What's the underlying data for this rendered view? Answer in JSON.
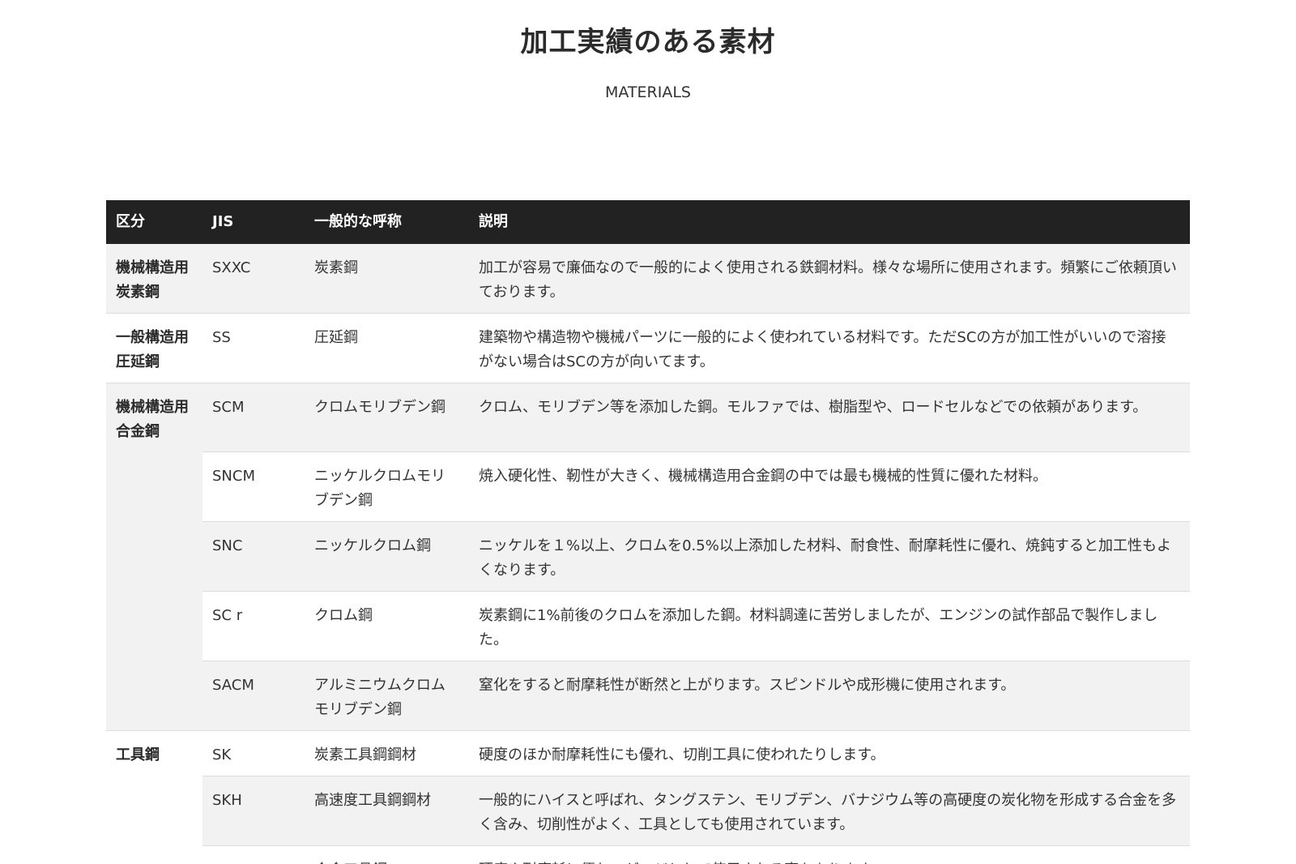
{
  "section": {
    "title": "加工実績のある素材",
    "subtitle": "MATERIALS"
  },
  "table": {
    "headers": [
      "区分",
      "JIS",
      "一般的な呼称",
      "説明"
    ],
    "rows": [
      {
        "category": "機械構造用炭素鋼",
        "jis": "SXXC",
        "name": "炭素鋼",
        "desc": "加工が容易で廉価なので一般的によく使用される鉄鋼材料。様々な場所に使用されます。頻繁にご依頼頂いております。"
      },
      {
        "category": "一般構造用圧延鋼",
        "jis": "SS",
        "name": "圧延鋼",
        "desc": "建築物や構造物や機械パーツに一般的によく使われている材料です。ただSCの方が加工性がいいので溶接がない場合はSCの方が向いてます。"
      },
      {
        "category": "機械構造用合金鋼",
        "jis": "SCM",
        "name": "クロムモリブデン鋼",
        "desc": "クロム、モリブデン等を添加した鋼。モルファでは、樹脂型や、ロードセルなどでの依頼があります。"
      },
      {
        "jis": "SNCM",
        "name": "ニッケルクロムモリブデン鋼",
        "desc": "焼入硬化性、靭性が大きく、機械構造用合金鋼の中では最も機械的性質に優れた材料。"
      },
      {
        "jis": "SNC",
        "name": "ニッケルクロム鋼",
        "desc": "ニッケルを１%以上、クロムを0.5%以上添加した材料、耐食性、耐摩耗性に優れ、焼鈍すると加工性もよくなります。"
      },
      {
        "jis": "SC r",
        "name": "クロム鋼",
        "desc": "炭素鋼に1%前後のクロムを添加した鋼。材料調達に苦労しましたが、エンジンの試作部品で製作しました。"
      },
      {
        "jis": "SACM",
        "name": "アルミニウムクロムモリブデン鋼",
        "desc": "窒化をすると耐摩耗性が断然と上がります。スピンドルや成形機に使用されます。"
      },
      {
        "category": "工具鋼",
        "jis": "SK",
        "name": "炭素工具鋼鋼材",
        "desc": "硬度のほか耐摩耗性にも優れ、切削工具に使われたりします。"
      },
      {
        "jis": "SKH",
        "name": "高速度工具鋼鋼材",
        "desc": "一般的にハイスと呼ばれ、タングステン、モリブデン、バナジウム等の高硬度の炭化物を形成する合金を多く含み、切削性がよく、工具としても使用されています。"
      },
      {
        "jis": "SKS",
        "name": "合金工具鋼",
        "desc": "硬度や耐摩耗に優れ、ゲージとして使用される事もあります。"
      }
    ]
  }
}
